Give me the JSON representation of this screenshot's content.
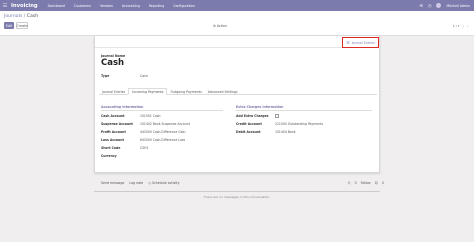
{
  "navbar": {
    "app_name": "Invoicing",
    "menu": [
      "Dashboard",
      "Customers",
      "Vendors",
      "Accounting",
      "Reporting",
      "Configuration"
    ],
    "user_name": "Mitchell Admin",
    "colors": {
      "navbar": "#7c7bad"
    }
  },
  "breadcrumb": {
    "parent": "Journals",
    "separator": "/",
    "current": "Cash"
  },
  "toolbar": {
    "edit_label": "Edit",
    "create_label": "Create",
    "action_label": "Action",
    "pager_text": "1 / 7"
  },
  "form": {
    "smart_button_label": "Journal Entries",
    "name_label": "Journal Name",
    "name_value": "Cash",
    "type_label": "Type",
    "type_value": "Cash",
    "tabs": [
      "Journal Entries",
      "Incoming Payments",
      "Outgoing Payments",
      "Advanced Settings"
    ],
    "accounting_section": {
      "title": "Accounting Information",
      "rows": [
        {
          "label": "Cash Account",
          "value": "101501 Cash"
        },
        {
          "label": "Suspense Account",
          "value": "101402 Bank Suspense Account"
        },
        {
          "label": "Profit Account",
          "value": "442000 Cash Difference Gain"
        },
        {
          "label": "Loss Account",
          "value": "642000 Cash Difference Loss"
        },
        {
          "label": "Short Code",
          "value": "CSH1"
        },
        {
          "label": "Currency",
          "value": ""
        }
      ]
    },
    "bank_fees_section": {
      "title": "Extra Charges information",
      "rows": [
        {
          "label": "Add Extra Charges",
          "value": ""
        },
        {
          "label": "Credit Account",
          "value": "211000 Outstanding Payments"
        },
        {
          "label": "Debit Account",
          "value": "101404 Bank"
        }
      ]
    }
  },
  "chatter": {
    "send_message": "Send message",
    "log_note": "Log note",
    "schedule_activity": "Schedule activity",
    "followers_count": "0",
    "follow_label": "Follow",
    "subscribers_count": "0",
    "empty_text": "There are no messages in this conversation."
  }
}
